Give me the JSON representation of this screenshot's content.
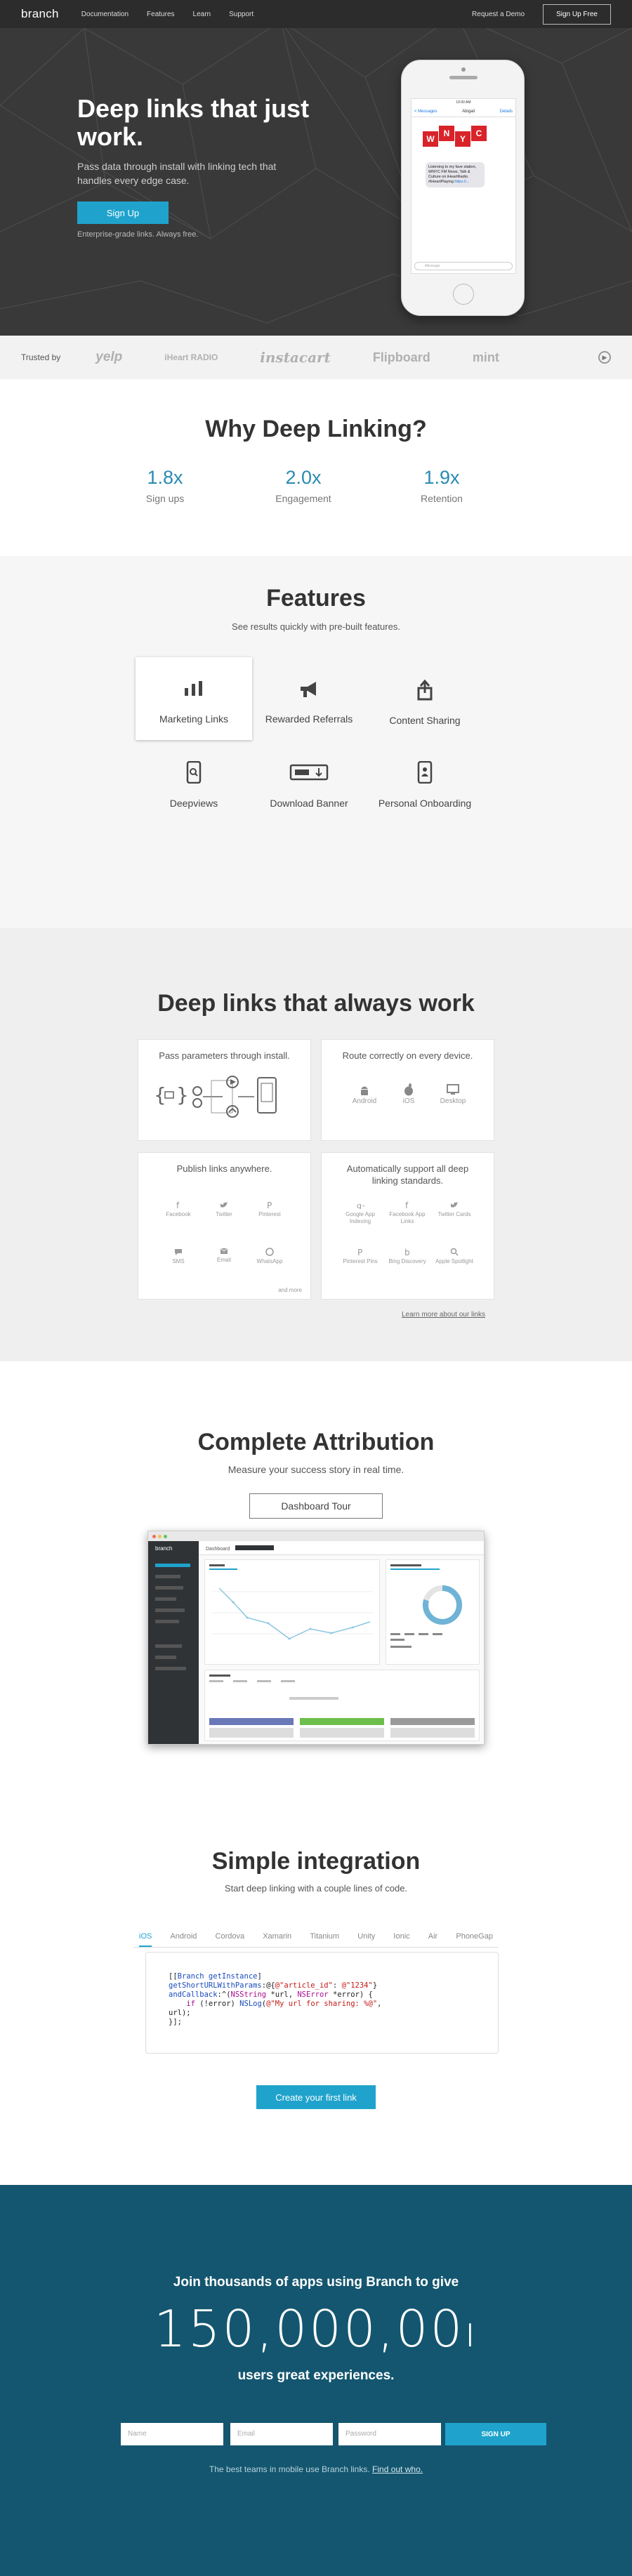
{
  "nav": {
    "logo": "branch",
    "links": [
      "Documentation",
      "Features",
      "Learn",
      "Support"
    ],
    "demo": "Request a Demo",
    "signup": "Sign Up Free"
  },
  "hero": {
    "title": "Deep links that just work.",
    "subtitle": "Pass data through install with linking tech that handles every edge case.",
    "cta": "Sign Up",
    "note": "Enterprise-grade links. Always free."
  },
  "phone": {
    "status": "10:00 AM",
    "back": "< Messages",
    "contact": "Abigail",
    "details": "Details",
    "logo_letters": [
      "W",
      "N",
      "Y",
      "C"
    ],
    "message": "Listening to my fave station, WNYC FM News, Talk & Culture on iHeartRadio. #iHeartPlaying",
    "message_link": "https://...",
    "input_placeholder": "iMessage"
  },
  "trusted": {
    "label": "Trusted by",
    "brands": [
      "yelp",
      "iHeart RADIO",
      "instacart",
      "Flipboard",
      "mint"
    ]
  },
  "why": {
    "title": "Why Deep Linking?",
    "stats": [
      {
        "value": "1.8x",
        "label": "Sign ups"
      },
      {
        "value": "2.0x",
        "label": "Engagement"
      },
      {
        "value": "1.9x",
        "label": "Retention"
      }
    ]
  },
  "features": {
    "title": "Features",
    "subtitle": "See results quickly with pre-built features.",
    "items": [
      {
        "label": "Marketing Links",
        "icon": "bar-chart-icon"
      },
      {
        "label": "Rewarded Referrals",
        "icon": "megaphone-icon"
      },
      {
        "label": "Content Sharing",
        "icon": "share-icon"
      },
      {
        "label": "Deepviews",
        "icon": "phone-search-icon"
      },
      {
        "label": "Download Banner",
        "icon": "banner-icon"
      },
      {
        "label": "Personal Onboarding",
        "icon": "phone-user-icon"
      }
    ]
  },
  "dlw": {
    "title": "Deep links that always work",
    "card1": "Pass parameters through install.",
    "card2": "Route correctly on every device.",
    "devices": [
      "Android",
      "iOS",
      "Desktop"
    ],
    "card3": "Publish links anywhere.",
    "channels": [
      "Facebook",
      "Twitter",
      "Pinterest",
      "SMS",
      "Email",
      "WhatsApp"
    ],
    "and_more": "and more",
    "card4": "Automatically support all deep linking standards.",
    "standards": [
      "Google App Indexing",
      "Facebook App Links",
      "Twitter Cards",
      "Pinterest Pins",
      "Bing Discovery",
      "Apple Spotlight"
    ],
    "learn_more": "Learn more about our links"
  },
  "attribution": {
    "title": "Complete Attribution",
    "subtitle": "Measure your success story in real time.",
    "button": "Dashboard Tour",
    "dash_title": "Dashboard"
  },
  "integration": {
    "title": "Simple integration",
    "subtitle": "Start deep linking with a couple lines of code.",
    "tabs": [
      "iOS",
      "Android",
      "Cordova",
      "Xamarin",
      "Titanium",
      "Unity",
      "Ionic",
      "Air",
      "PhoneGap"
    ],
    "active_tab": "iOS",
    "button": "Create your first link"
  },
  "join": {
    "line1": "Join thousands of apps using Branch to give",
    "number": "150,000,00",
    "line2": "users great experiences.",
    "name_placeholder": "Name",
    "email_placeholder": "Email",
    "password_placeholder": "Password",
    "button": "SIGN UP",
    "footer": "The best teams in mobile use Branch links.",
    "footer_link": "Find out who."
  },
  "colors": {
    "accent": "#1fa3cc",
    "stat": "#2a8ab1",
    "hero_bg": "#3a3939",
    "footer_bg": "#14566f"
  }
}
